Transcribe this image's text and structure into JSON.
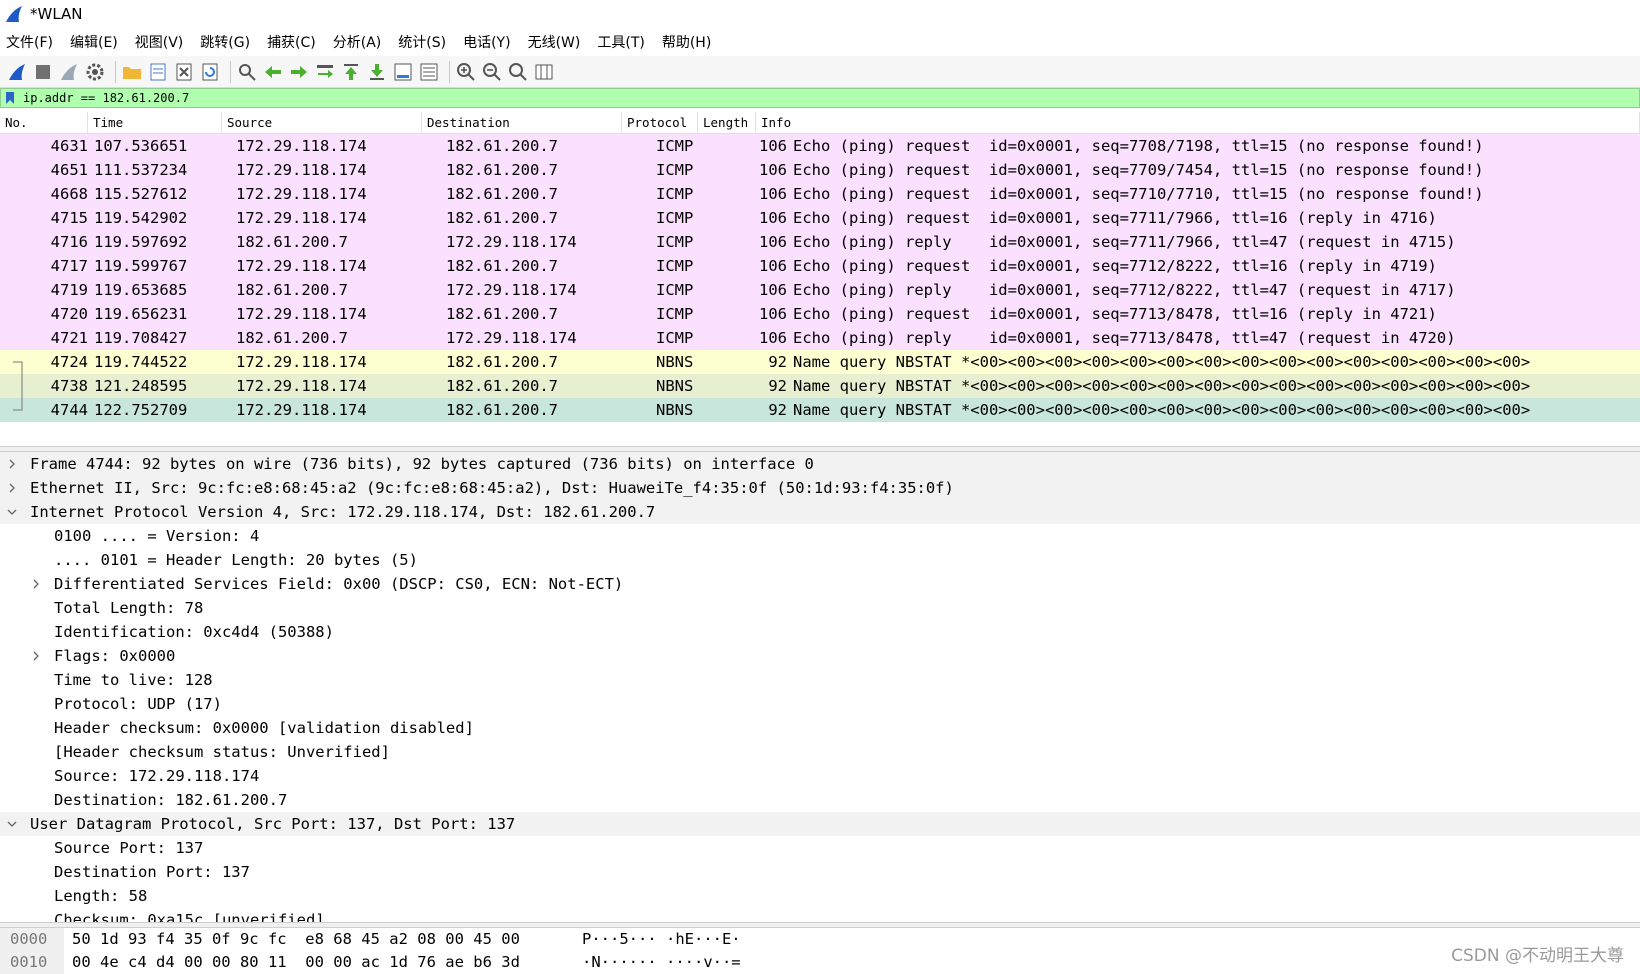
{
  "window": {
    "title": "*WLAN"
  },
  "menu": [
    "文件(F)",
    "编辑(E)",
    "视图(V)",
    "跳转(G)",
    "捕获(C)",
    "分析(A)",
    "统计(S)",
    "电话(Y)",
    "无线(W)",
    "工具(T)",
    "帮助(H)"
  ],
  "toolbar": [
    {
      "icon": "shark-fin-start-icon",
      "color": "#1e5bc6"
    },
    {
      "icon": "stop-square-icon",
      "color": "#707070"
    },
    {
      "icon": "restart-fin-icon",
      "color": "#9aa8b8"
    },
    {
      "icon": "capture-options-gear-icon",
      "color": "#555555"
    },
    {
      "sep": true
    },
    {
      "icon": "open-folder-icon",
      "color": "#f2b636"
    },
    {
      "icon": "save-file-icon",
      "color": "#4a78c0"
    },
    {
      "icon": "close-file-icon",
      "color": "#555555"
    },
    {
      "icon": "reload-file-icon",
      "color": "#2d7bd2"
    },
    {
      "sep": true
    },
    {
      "icon": "find-packet-icon",
      "color": "#555555"
    },
    {
      "icon": "go-back-arrow-icon",
      "color": "#4caf2f"
    },
    {
      "icon": "go-forward-arrow-icon",
      "color": "#4caf2f"
    },
    {
      "icon": "go-to-packet-icon",
      "color": "#4caf2f"
    },
    {
      "icon": "go-first-packet-icon",
      "color": "#4caf2f"
    },
    {
      "icon": "go-last-packet-icon",
      "color": "#4caf2f"
    },
    {
      "icon": "autoscroll-icon",
      "color": "#2d7bd2"
    },
    {
      "icon": "colorize-list-icon",
      "color": "#555555"
    },
    {
      "sep": true
    },
    {
      "icon": "zoom-in-icon",
      "color": "#555555"
    },
    {
      "icon": "zoom-out-icon",
      "color": "#555555"
    },
    {
      "icon": "zoom-normal-icon",
      "color": "#555555"
    },
    {
      "icon": "resize-columns-icon",
      "color": "#555555"
    }
  ],
  "filter": {
    "value": "ip.addr == 182.61.200.7",
    "bg": "#afffaf"
  },
  "columns": [
    "No.",
    "Time",
    "Source",
    "Destination",
    "Protocol",
    "Length",
    "Info"
  ],
  "packets": [
    {
      "no": "4631",
      "time": "107.536651",
      "src": "172.29.118.174",
      "dst": "182.61.200.7",
      "proto": "ICMP",
      "len": "106",
      "info": "Echo (ping) request  id=0x0001, seq=7708/7198, ttl=15 (no response found!)",
      "kind": "icmp"
    },
    {
      "no": "4651",
      "time": "111.537234",
      "src": "172.29.118.174",
      "dst": "182.61.200.7",
      "proto": "ICMP",
      "len": "106",
      "info": "Echo (ping) request  id=0x0001, seq=7709/7454, ttl=15 (no response found!)",
      "kind": "icmp"
    },
    {
      "no": "4668",
      "time": "115.527612",
      "src": "172.29.118.174",
      "dst": "182.61.200.7",
      "proto": "ICMP",
      "len": "106",
      "info": "Echo (ping) request  id=0x0001, seq=7710/7710, ttl=15 (no response found!)",
      "kind": "icmp"
    },
    {
      "no": "4715",
      "time": "119.542902",
      "src": "172.29.118.174",
      "dst": "182.61.200.7",
      "proto": "ICMP",
      "len": "106",
      "info": "Echo (ping) request  id=0x0001, seq=7711/7966, ttl=16 (reply in 4716)",
      "kind": "icmp"
    },
    {
      "no": "4716",
      "time": "119.597692",
      "src": "182.61.200.7",
      "dst": "172.29.118.174",
      "proto": "ICMP",
      "len": "106",
      "info": "Echo (ping) reply    id=0x0001, seq=7711/7966, ttl=47 (request in 4715)",
      "kind": "icmp"
    },
    {
      "no": "4717",
      "time": "119.599767",
      "src": "172.29.118.174",
      "dst": "182.61.200.7",
      "proto": "ICMP",
      "len": "106",
      "info": "Echo (ping) request  id=0x0001, seq=7712/8222, ttl=16 (reply in 4719)",
      "kind": "icmp"
    },
    {
      "no": "4719",
      "time": "119.653685",
      "src": "182.61.200.7",
      "dst": "172.29.118.174",
      "proto": "ICMP",
      "len": "106",
      "info": "Echo (ping) reply    id=0x0001, seq=7712/8222, ttl=47 (request in 4717)",
      "kind": "icmp"
    },
    {
      "no": "4720",
      "time": "119.656231",
      "src": "172.29.118.174",
      "dst": "182.61.200.7",
      "proto": "ICMP",
      "len": "106",
      "info": "Echo (ping) request  id=0x0001, seq=7713/8478, ttl=16 (reply in 4721)",
      "kind": "icmp"
    },
    {
      "no": "4721",
      "time": "119.708427",
      "src": "182.61.200.7",
      "dst": "172.29.118.174",
      "proto": "ICMP",
      "len": "106",
      "info": "Echo (ping) reply    id=0x0001, seq=7713/8478, ttl=47 (request in 4720)",
      "kind": "icmp"
    },
    {
      "no": "4724",
      "time": "119.744522",
      "src": "172.29.118.174",
      "dst": "182.61.200.7",
      "proto": "NBNS",
      "len": "92",
      "info": "Name query NBSTAT *<00><00><00><00><00><00><00><00><00><00><00><00><00><00><00>",
      "kind": "nbns-a",
      "rel": "top"
    },
    {
      "no": "4738",
      "time": "121.248595",
      "src": "172.29.118.174",
      "dst": "182.61.200.7",
      "proto": "NBNS",
      "len": "92",
      "info": "Name query NBSTAT *<00><00><00><00><00><00><00><00><00><00><00><00><00><00><00>",
      "kind": "nbns-b",
      "rel": "mid"
    },
    {
      "no": "4744",
      "time": "122.752709",
      "src": "172.29.118.174",
      "dst": "182.61.200.7",
      "proto": "NBNS",
      "len": "92",
      "info": "Name query NBSTAT *<00><00><00><00><00><00><00><00><00><00><00><00><00><00><00>",
      "kind": "selected",
      "rel": "bottom"
    }
  ],
  "details": [
    {
      "level": 0,
      "arrow": "right",
      "text": "Frame 4744: 92 bytes on wire (736 bits), 92 bytes captured (736 bits) on interface 0"
    },
    {
      "level": 0,
      "arrow": "right",
      "text": "Ethernet II, Src: 9c:fc:e8:68:45:a2 (9c:fc:e8:68:45:a2), Dst: HuaweiTe_f4:35:0f (50:1d:93:f4:35:0f)"
    },
    {
      "level": 0,
      "arrow": "down",
      "text": "Internet Protocol Version 4, Src: 172.29.118.174, Dst: 182.61.200.7"
    },
    {
      "level": 1,
      "arrow": "",
      "text": "0100 .... = Version: 4"
    },
    {
      "level": 1,
      "arrow": "",
      "text": ".... 0101 = Header Length: 20 bytes (5)"
    },
    {
      "level": 1,
      "arrow": "right",
      "text": "Differentiated Services Field: 0x00 (DSCP: CS0, ECN: Not-ECT)"
    },
    {
      "level": 1,
      "arrow": "",
      "text": "Total Length: 78"
    },
    {
      "level": 1,
      "arrow": "",
      "text": "Identification: 0xc4d4 (50388)"
    },
    {
      "level": 1,
      "arrow": "right",
      "text": "Flags: 0x0000"
    },
    {
      "level": 1,
      "arrow": "",
      "text": "Time to live: 128"
    },
    {
      "level": 1,
      "arrow": "",
      "text": "Protocol: UDP (17)"
    },
    {
      "level": 1,
      "arrow": "",
      "text": "Header checksum: 0x0000 [validation disabled]"
    },
    {
      "level": 1,
      "arrow": "",
      "text": "[Header checksum status: Unverified]"
    },
    {
      "level": 1,
      "arrow": "",
      "text": "Source: 172.29.118.174"
    },
    {
      "level": 1,
      "arrow": "",
      "text": "Destination: 182.61.200.7"
    },
    {
      "level": 0,
      "arrow": "down",
      "text": "User Datagram Protocol, Src Port: 137, Dst Port: 137"
    },
    {
      "level": 1,
      "arrow": "",
      "text": "Source Port: 137"
    },
    {
      "level": 1,
      "arrow": "",
      "text": "Destination Port: 137"
    },
    {
      "level": 1,
      "arrow": "",
      "text": "Length: 58"
    },
    {
      "level": 1,
      "arrow": "",
      "text": "Checksum: 0xa15c [unverified]"
    }
  ],
  "bytes": [
    {
      "offset": "0000",
      "hex": "50 1d 93 f4 35 0f 9c fc  e8 68 45 a2 08 00 45 00",
      "ascii": "P···5··· ·hE···E·"
    },
    {
      "offset": "0010",
      "hex": "00 4e c4 d4 00 00 80 11  00 00 ac 1d 76 ae b6 3d",
      "ascii": "·N······ ····v··="
    }
  ],
  "watermark": "CSDN @不动明王大尊"
}
